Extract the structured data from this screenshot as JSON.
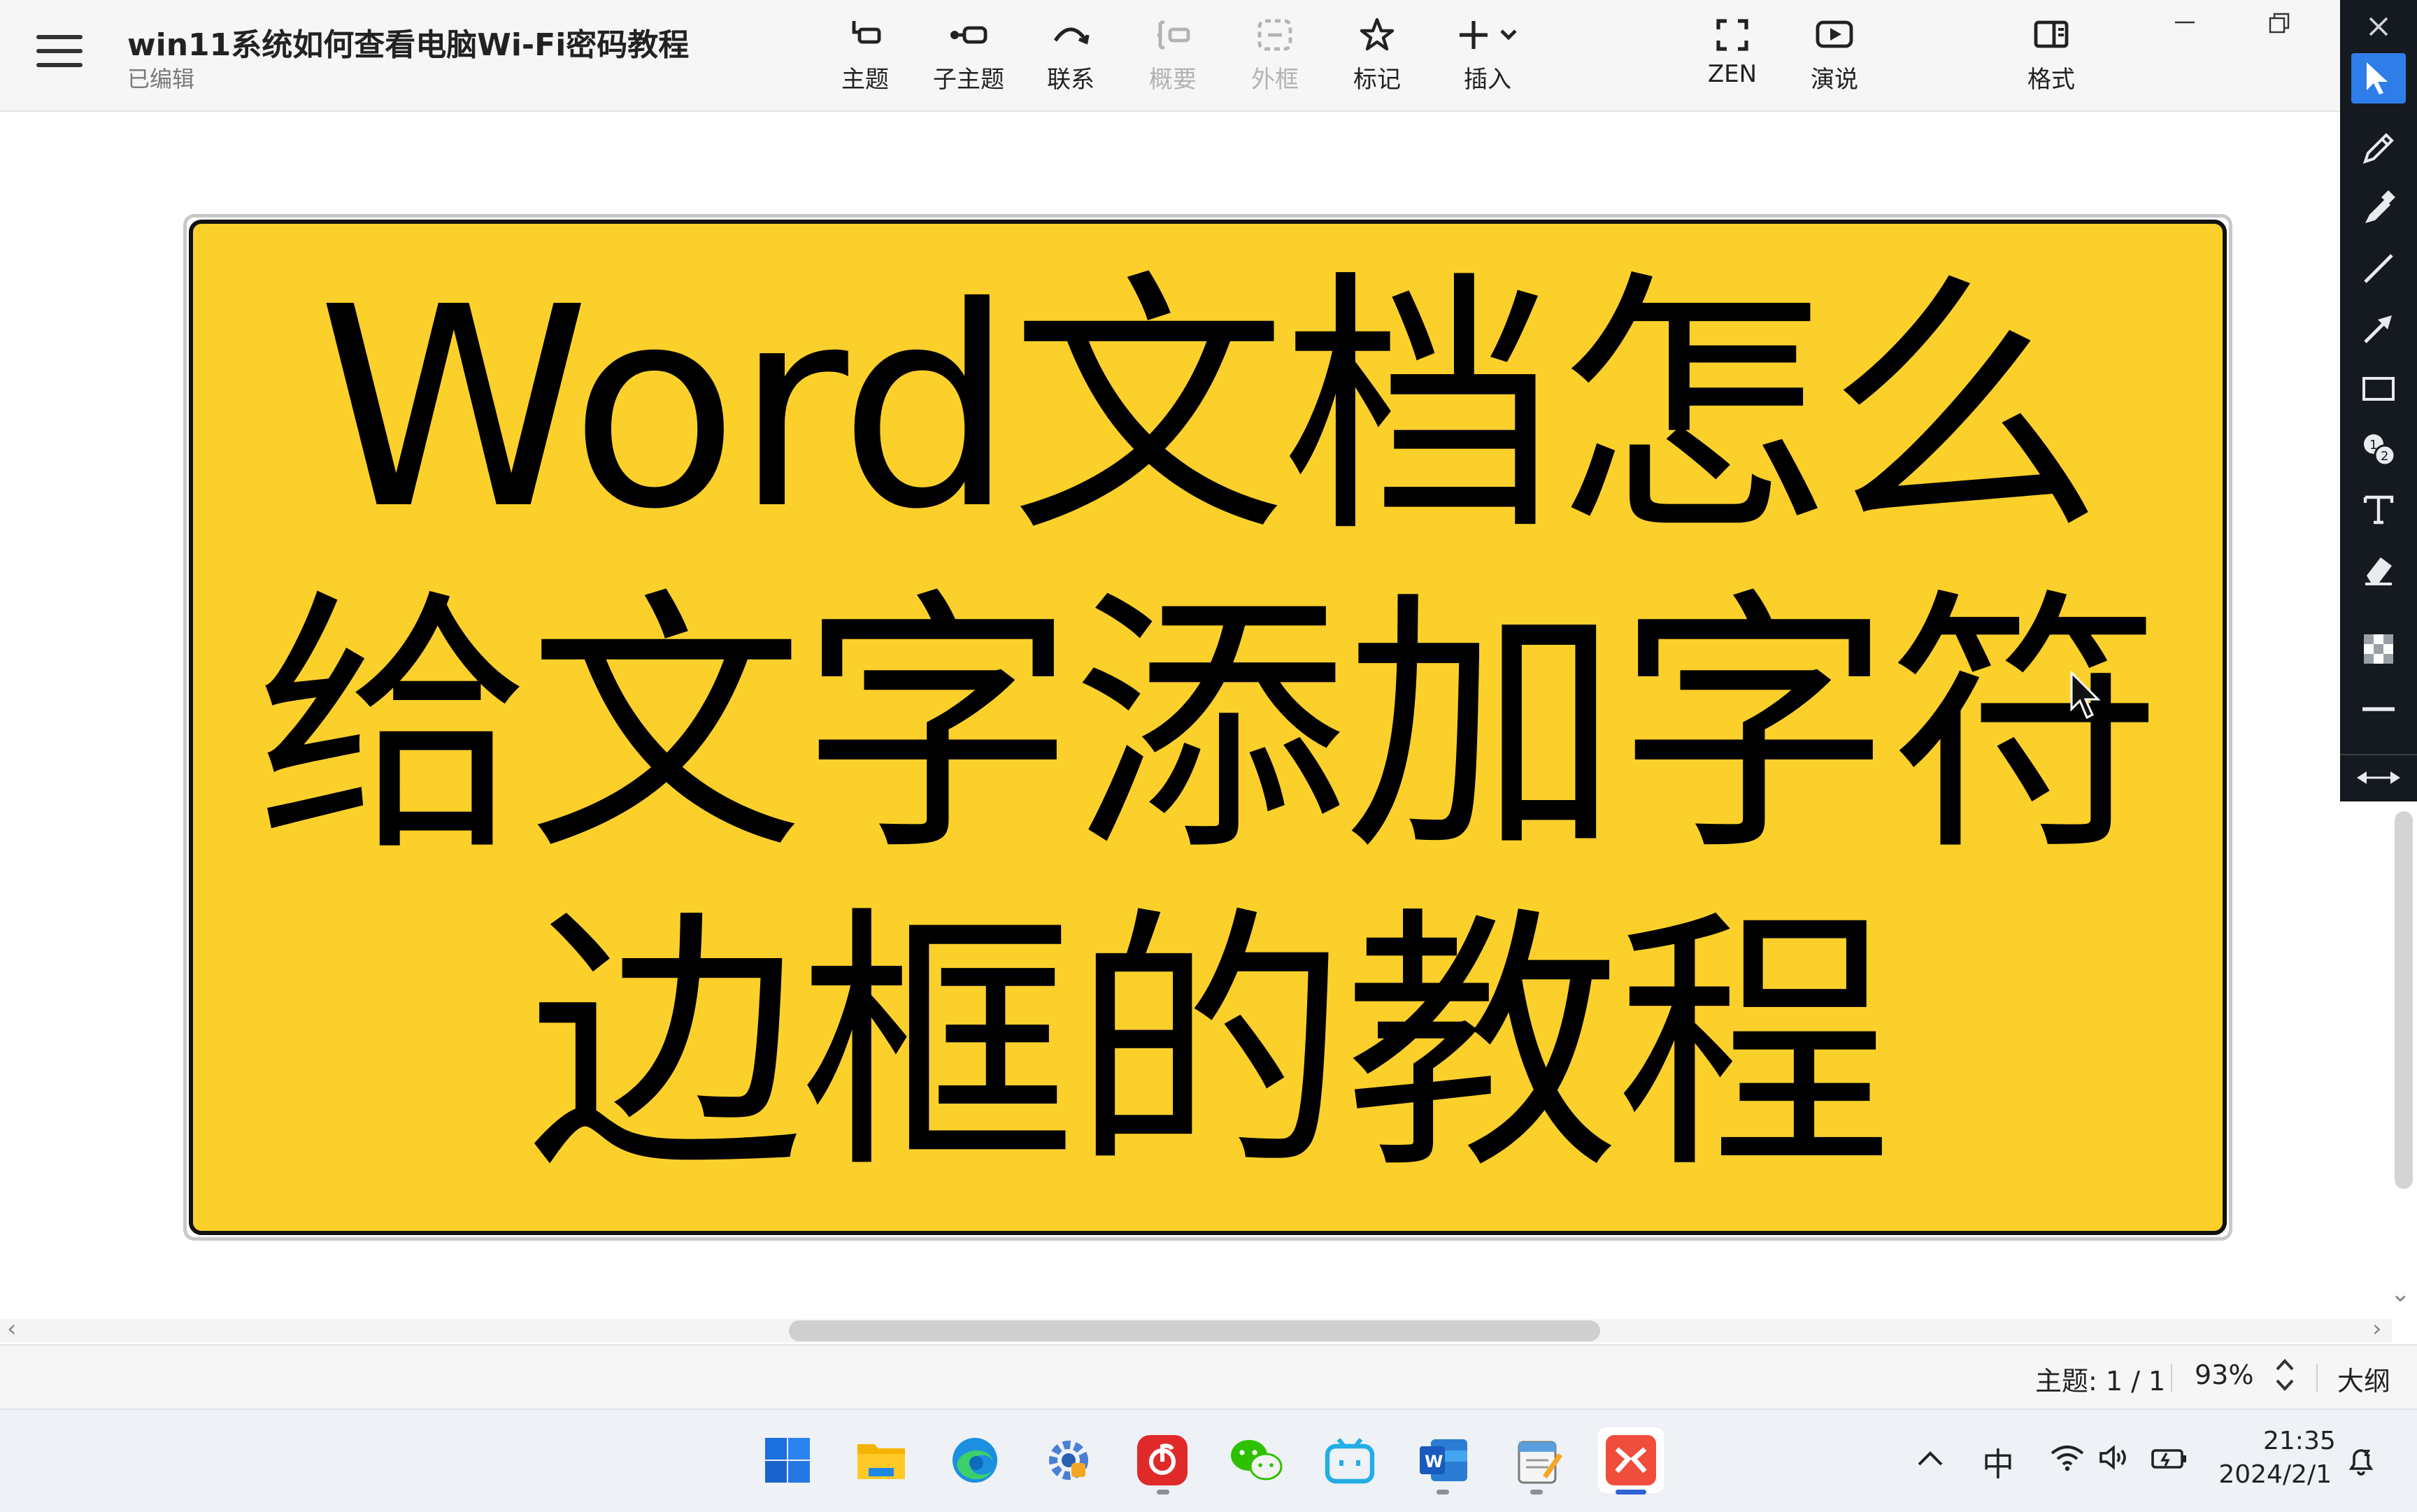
{
  "app": {
    "title": "win11系统如何查看电脑Wi-Fi密码教程",
    "status": "已编辑"
  },
  "toolbar": {
    "items": [
      {
        "label": "主题",
        "icon": "topic-icon"
      },
      {
        "label": "子主题",
        "icon": "subtopic-icon"
      },
      {
        "label": "联系",
        "icon": "relationship-icon"
      },
      {
        "label": "概要",
        "icon": "summary-icon",
        "disabled": true
      },
      {
        "label": "外框",
        "icon": "boundary-icon",
        "disabled": true
      },
      {
        "label": "标记",
        "icon": "star-icon"
      },
      {
        "label": "插入",
        "icon": "plus-icon"
      },
      {
        "label": "ZEN",
        "icon": "zen-icon"
      },
      {
        "label": "演说",
        "icon": "present-icon"
      },
      {
        "label": "格式",
        "icon": "format-panel-icon"
      }
    ]
  },
  "canvas": {
    "topic_text": "Word文档怎么给文字添加字符边框的教程",
    "topic_fill": "#fcd02b",
    "topic_border": "#111111"
  },
  "statusbar": {
    "topic_count": "主题: 1 / 1",
    "zoom": "93%",
    "outline": "大纲"
  },
  "palette": {
    "active_color": "#2f7de9",
    "tools": [
      "pointer-icon",
      "pen-icon",
      "marker-icon",
      "line-icon",
      "arrow-icon",
      "rectangle-icon",
      "number-stamp-icon",
      "text-icon",
      "eraser-icon",
      "opacity-icon",
      "line-width-icon",
      "collapse-icon"
    ]
  },
  "taskbar": {
    "apps": [
      "start-icon",
      "file-explorer-icon",
      "edge-icon",
      "settings-app-icon",
      "netease-music-icon",
      "wechat-icon",
      "bilibili-icon",
      "word-icon",
      "notepad-icon",
      "xmind-icon"
    ],
    "ime": "中",
    "time": "21:35",
    "date": "2024/2/1"
  }
}
